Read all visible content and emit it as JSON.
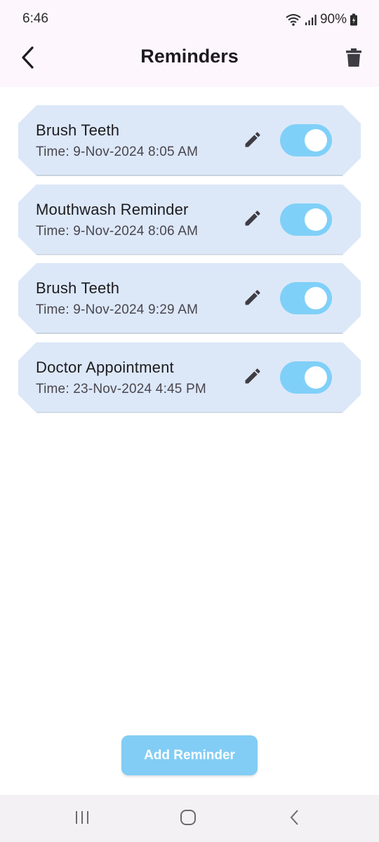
{
  "status": {
    "time": "6:46",
    "battery": "90%"
  },
  "header": {
    "title": "Reminders",
    "icons": [
      "back-arrow-icon",
      "trash-icon"
    ]
  },
  "reminders": [
    {
      "title": "Brush Teeth",
      "time": "Time: 9-Nov-2024 8:05 AM",
      "enabled": true
    },
    {
      "title": "Mouthwash Reminder",
      "time": "Time: 9-Nov-2024 8:06 AM",
      "enabled": true
    },
    {
      "title": "Brush Teeth",
      "time": "Time: 9-Nov-2024 9:29 AM",
      "enabled": true
    },
    {
      "title": "Doctor Appointment",
      "time": "Time: 23-Nov-2024 4:45 PM",
      "enabled": true
    }
  ],
  "add_button": {
    "label": "Add Reminder"
  },
  "nav": {
    "icons": [
      "recents-icon",
      "home-icon",
      "back-icon"
    ]
  },
  "colors": {
    "card_bg": "#dce8f8",
    "toggle_on": "#7fd0f8",
    "add_button": "#82cdf5",
    "app_bar": "#fdf7fd"
  }
}
